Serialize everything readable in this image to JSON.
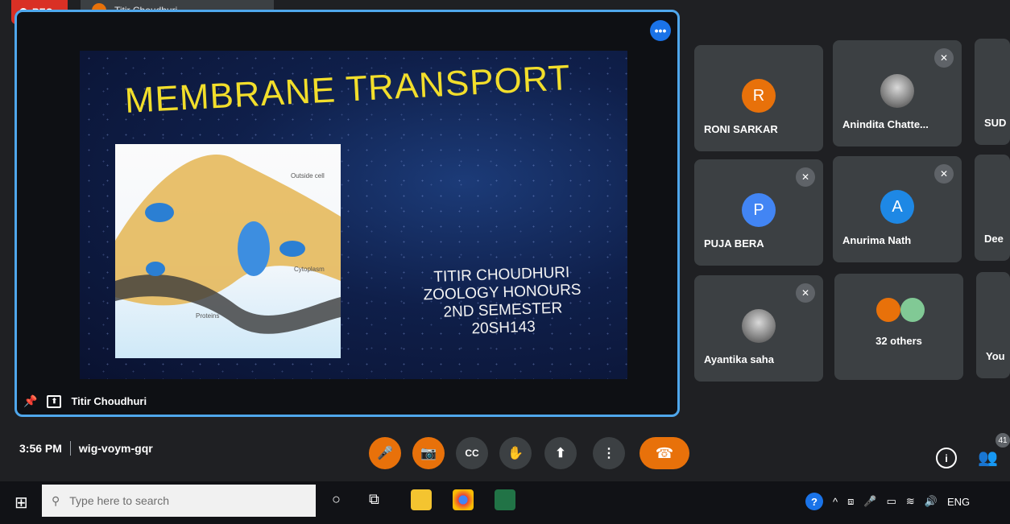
{
  "top": {
    "rec_label": "REC",
    "pinned_name": "Titir Choudhuri"
  },
  "slide": {
    "title": "MEMBRANE TRANSPORT",
    "info_lines": [
      "TITIR CHOUDHURI",
      "ZOOLOGY HONOURS",
      "2ND SEMESTER",
      "20SH143"
    ],
    "diagram_labels": [
      "Outside cell",
      "Cytoplasm",
      "Proteins"
    ]
  },
  "presenter": {
    "name": "Titir Choudhuri",
    "pin_icon": "pin-icon",
    "screen_icon": "present-screen-icon"
  },
  "participants": [
    {
      "name": "RONI SARKAR",
      "initial": "R",
      "avatar_color": "#e8710a",
      "muted": false
    },
    {
      "name": "Anindita Chatte...",
      "initial": "",
      "avatar_color": "photo",
      "muted": true
    },
    {
      "name": "SUD",
      "initial": "",
      "avatar_color": "#3c4043",
      "muted": false
    },
    {
      "name": "PUJA BERA",
      "initial": "P",
      "avatar_color": "#4285f4",
      "muted": true
    },
    {
      "name": "Anurima Nath",
      "initial": "A",
      "avatar_color": "#1e88e5",
      "muted": true
    },
    {
      "name": "Dee",
      "initial": "",
      "avatar_color": "#3c4043",
      "muted": false
    },
    {
      "name": "Ayantika saha",
      "initial": "",
      "avatar_color": "photo",
      "muted": true
    },
    {
      "name": "32 others",
      "initial": "",
      "avatar_color": "group",
      "muted": false
    },
    {
      "name": "You",
      "initial": "",
      "avatar_color": "#3c4043",
      "muted": false
    }
  ],
  "meeting": {
    "time": "3:56 PM",
    "code": "wig-voym-gqr",
    "people_count": "41",
    "controls": [
      {
        "name": "mic-off-button",
        "icon": "mic-off-icon",
        "glyph": "🎤",
        "style": "red"
      },
      {
        "name": "camera-off-button",
        "icon": "camera-off-icon",
        "glyph": "📷",
        "style": "red"
      },
      {
        "name": "captions-button",
        "icon": "captions-icon",
        "glyph": "CC",
        "style": "grey"
      },
      {
        "name": "raise-hand-button",
        "icon": "hand-icon",
        "glyph": "✋",
        "style": "grey"
      },
      {
        "name": "present-button",
        "icon": "present-icon",
        "glyph": "⬆",
        "style": "grey"
      },
      {
        "name": "more-options-button",
        "icon": "more-vert-icon",
        "glyph": "⋮",
        "style": "grey"
      }
    ]
  },
  "taskbar": {
    "search_placeholder": "Type here to search",
    "language": "ENG"
  }
}
